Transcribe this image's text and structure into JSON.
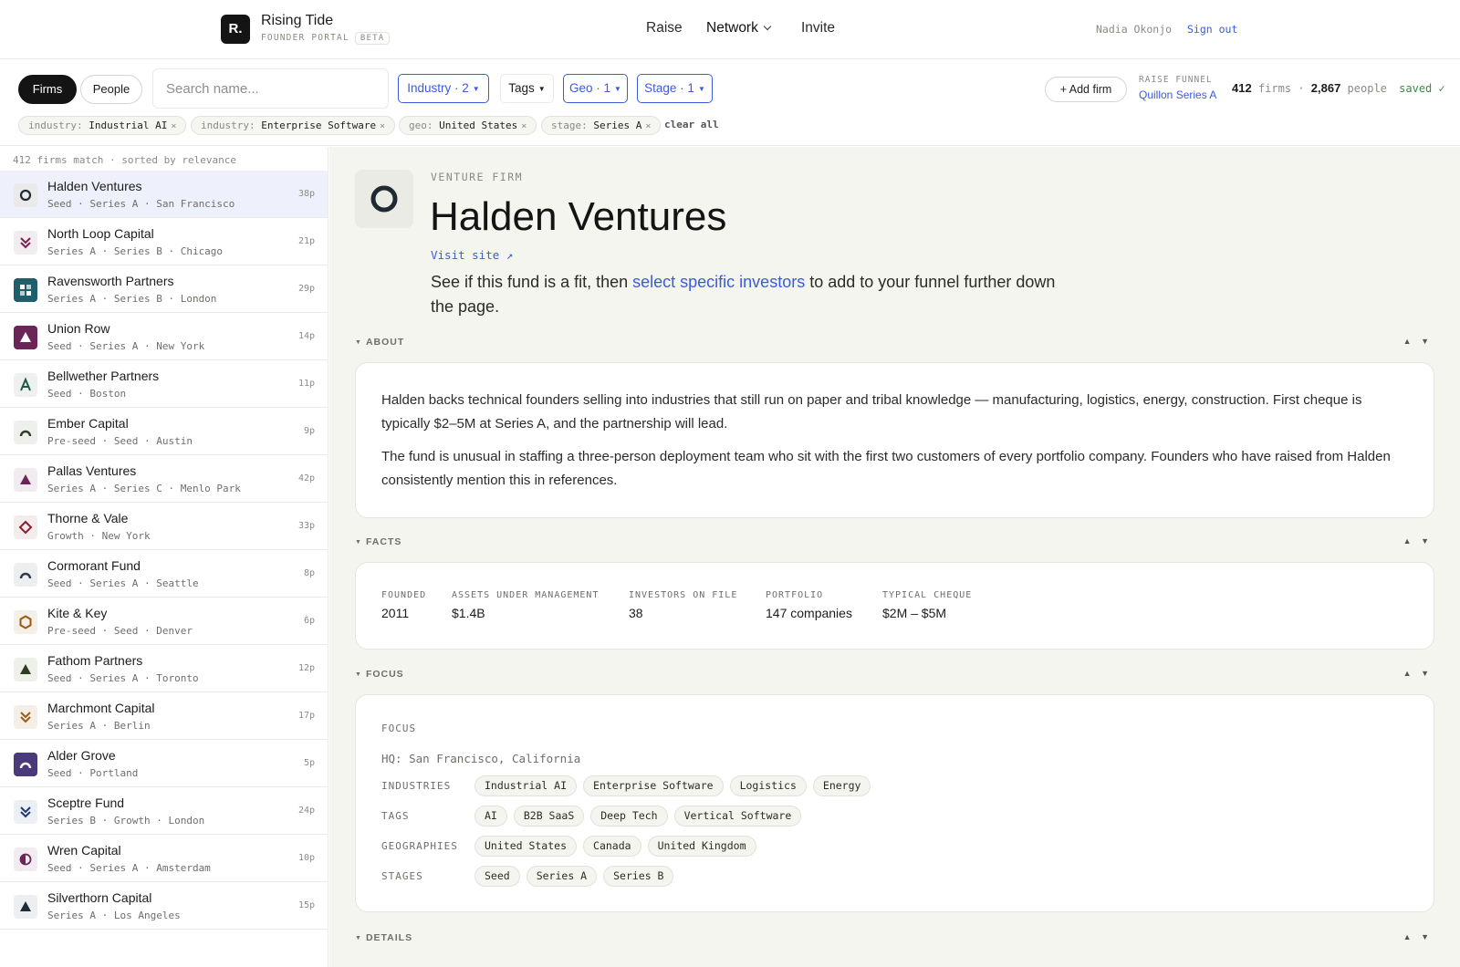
{
  "app": {
    "logo_letter": "R.",
    "name": "Rising Tide",
    "subtitle": "FOUNDER PORTAL",
    "badge": "BETA"
  },
  "nav": {
    "raise": "Raise",
    "network": "Network",
    "invite": "Invite"
  },
  "user": {
    "name": "Nadia Okonjo",
    "sign_out": "Sign out"
  },
  "filters": {
    "segments": {
      "firms": "Firms",
      "people": "People"
    },
    "search_placeholder": "Search name...",
    "industry": "Industry · 2",
    "tags": "Tags",
    "geo": "Geo · 1",
    "stage": "Stage · 1",
    "chips": [
      {
        "key": "industry:",
        "value": "Industrial AI"
      },
      {
        "key": "industry:",
        "value": "Enterprise Software"
      },
      {
        "key": "geo:",
        "value": "United States"
      },
      {
        "key": "stage:",
        "value": "Series A"
      }
    ],
    "chip_close": "×",
    "clear_all": "clear all"
  },
  "funnel": {
    "add_firm": "+ Add firm",
    "label": "RAISE FUNNEL",
    "name": "Quillon Series A",
    "firms_count": "412",
    "firms_word": "firms",
    "sep": "·",
    "people_count": "2,867",
    "people_word": "people",
    "saved": "saved ✓"
  },
  "list": {
    "summary": "412 firms match · sorted by relevance",
    "firms": [
      {
        "name": "Halden Ventures",
        "meta": "Seed · Series A · San Francisco",
        "count": "38p",
        "icon": "circle-icon",
        "color": "#1f2a33",
        "bg": "#eaeaea",
        "active": true
      },
      {
        "name": "North Loop Capital",
        "meta": "Series A · Series B · Chicago",
        "count": "21p",
        "icon": "double-chevron-icon",
        "color": "#7a2250",
        "bg": "#f1ecef"
      },
      {
        "name": "Ravensworth Partners",
        "meta": "Series A · Series B · London",
        "count": "29p",
        "icon": "grid-icon",
        "color": "#ffffff",
        "bg": "#1f5e6b"
      },
      {
        "name": "Union Row",
        "meta": "Seed · Series A · New York",
        "count": "14p",
        "icon": "triangle-icon",
        "color": "#ffffff",
        "bg": "#6b2556"
      },
      {
        "name": "Bellwether Partners",
        "meta": "Seed · Boston",
        "count": "11p",
        "icon": "letter-a-icon",
        "color": "#1e5a4a",
        "bg": "#eef1ef"
      },
      {
        "name": "Ember Capital",
        "meta": "Pre-seed · Seed · Austin",
        "count": "9p",
        "icon": "arch-icon",
        "color": "#2f3d2a",
        "bg": "#eef0ec"
      },
      {
        "name": "Pallas Ventures",
        "meta": "Series A · Series C · Menlo Park",
        "count": "42p",
        "icon": "triangle-icon",
        "color": "#6b2556",
        "bg": "#f2ecf0"
      },
      {
        "name": "Thorne & Vale",
        "meta": "Growth · New York",
        "count": "33p",
        "icon": "diamond-icon",
        "color": "#8a1d2e",
        "bg": "#f3ecec"
      },
      {
        "name": "Cormorant Fund",
        "meta": "Seed · Series A · Seattle",
        "count": "8p",
        "icon": "arch-icon",
        "color": "#2a3a4a",
        "bg": "#eceef0"
      },
      {
        "name": "Kite & Key",
        "meta": "Pre-seed · Seed · Denver",
        "count": "6p",
        "icon": "hexagon-icon",
        "color": "#9a5a12",
        "bg": "#f4efe8"
      },
      {
        "name": "Fathom Partners",
        "meta": "Seed · Series A · Toronto",
        "count": "12p",
        "icon": "triangle-icon",
        "color": "#2f3a22",
        "bg": "#eef0ea"
      },
      {
        "name": "Marchmont Capital",
        "meta": "Series A · Berlin",
        "count": "17p",
        "icon": "double-chevron-icon",
        "color": "#9a5a12",
        "bg": "#f4efe6"
      },
      {
        "name": "Alder Grove",
        "meta": "Seed · Portland",
        "count": "5p",
        "icon": "arch-icon",
        "color": "#ffffff",
        "bg": "#4a3a7a"
      },
      {
        "name": "Sceptre Fund",
        "meta": "Series B · Growth · London",
        "count": "24p",
        "icon": "double-chevron-icon",
        "color": "#1f3a6b",
        "bg": "#eceff4"
      },
      {
        "name": "Wren Capital",
        "meta": "Seed · Series A · Amsterdam",
        "count": "10p",
        "icon": "half-circle-icon",
        "color": "#6b2556",
        "bg": "#f2ecf0"
      },
      {
        "name": "Silverthorn Capital",
        "meta": "Series A · Los Angeles",
        "count": "15p",
        "icon": "triangle-icon",
        "color": "#1f2a3a",
        "bg": "#eceef1"
      }
    ]
  },
  "detail": {
    "kicker": "VENTURE FIRM",
    "name": "Halden Ventures",
    "visit": "Visit site ↗",
    "intro_pre": "See if this fund is a fit, then ",
    "intro_link": "select specific investors",
    "intro_post": " to add to your funnel further down the page.",
    "arrows": "▲ ▼",
    "about": {
      "heading": "ABOUT",
      "p1": "Halden backs technical founders selling into industries that still run on paper and tribal knowledge — manufacturing, logistics, energy, construction. First cheque is typically $2–5M at Series A, and the partnership will lead.",
      "p2": "The fund is unusual in staffing a three-person deployment team who sit with the first two customers of every portfolio company. Founders who have raised from Halden consistently mention this in references."
    },
    "facts": {
      "heading": "FACTS",
      "items": [
        {
          "label": "FOUNDED",
          "value": "2011"
        },
        {
          "label": "ASSETS UNDER MANAGEMENT",
          "value": "$1.4B"
        },
        {
          "label": "INVESTORS ON FILE",
          "value": "38"
        },
        {
          "label": "PORTFOLIO",
          "value": "147 companies"
        },
        {
          "label": "TYPICAL CHEQUE",
          "value": "$2M – $5M"
        }
      ]
    },
    "focus": {
      "heading": "FOCUS",
      "title": "FOCUS",
      "hq": "HQ: San Francisco, California",
      "industries_label": "INDUSTRIES",
      "industries": [
        "Industrial AI",
        "Enterprise Software",
        "Logistics",
        "Energy"
      ],
      "tags_label": "TAGS",
      "tags": [
        "AI",
        "B2B SaaS",
        "Deep Tech",
        "Vertical Software"
      ],
      "geographies_label": "GEOGRAPHIES",
      "geographies": [
        "United States",
        "Canada",
        "United Kingdom"
      ],
      "stages_label": "STAGES",
      "stages": [
        "Seed",
        "Series A",
        "Series B"
      ]
    },
    "details": {
      "heading": "DETAILS"
    }
  }
}
